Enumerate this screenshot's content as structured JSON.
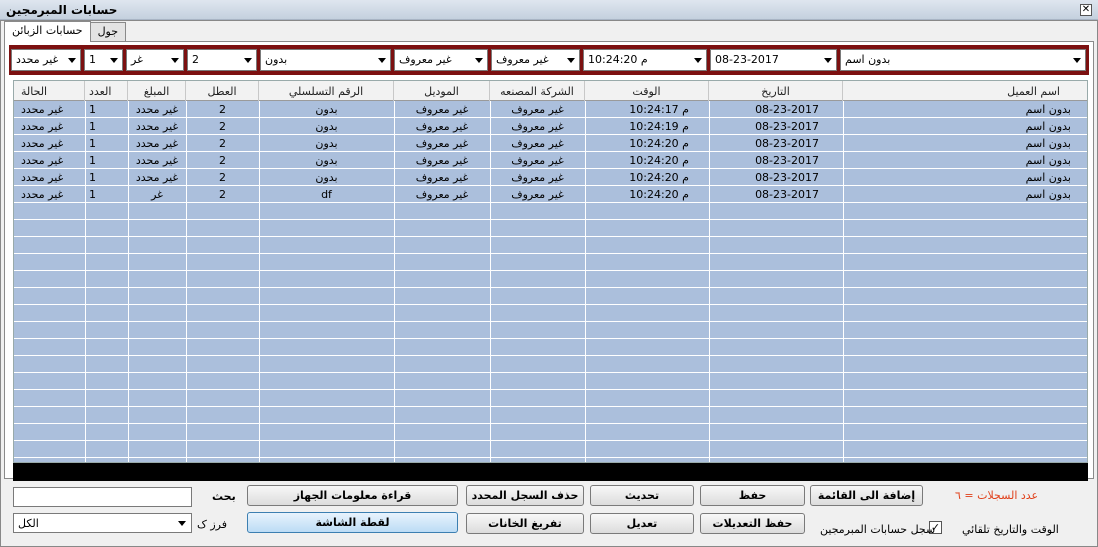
{
  "window": {
    "title": "حسابات المبرمجين",
    "close_glyph": "✕"
  },
  "tabs": [
    {
      "label": "حسابات الزبائن"
    },
    {
      "label": "جول"
    }
  ],
  "filters": {
    "customer_name": "بدون اسم",
    "date": "08-23-2017",
    "time": "م 10:24:20",
    "company": "غير معروف",
    "model": "غير معروف",
    "serial": "بدون",
    "fault": "2",
    "amount": "غر",
    "count": "1",
    "status": "غير محدد"
  },
  "table": {
    "headers": {
      "customer_name": "اسم العميل",
      "date": "التاريخ",
      "time": "الوقت",
      "company": "الشركة المصنعه",
      "model": "الموديل",
      "serial": "الرقم التسلسلي",
      "fault": "العطل",
      "amount": "المبلغ",
      "count": "العدد",
      "status": "الحالة"
    },
    "rows": [
      {
        "customer_name": "بدون اسم",
        "date": "08-23-2017",
        "time": "م 10:24:17",
        "company": "غير معروف",
        "model": "غير معروف",
        "serial": "بدون",
        "fault": "2",
        "amount": "غير محدد",
        "count": "1",
        "status": "غير محدد"
      },
      {
        "customer_name": "بدون اسم",
        "date": "08-23-2017",
        "time": "م 10:24:19",
        "company": "غير معروف",
        "model": "غير معروف",
        "serial": "بدون",
        "fault": "2",
        "amount": "غير محدد",
        "count": "1",
        "status": "غير محدد"
      },
      {
        "customer_name": "بدون اسم",
        "date": "08-23-2017",
        "time": "م 10:24:20",
        "company": "غير معروف",
        "model": "غير معروف",
        "serial": "بدون",
        "fault": "2",
        "amount": "غير محدد",
        "count": "1",
        "status": "غير محدد"
      },
      {
        "customer_name": "بدون اسم",
        "date": "08-23-2017",
        "time": "م 10:24:20",
        "company": "غير معروف",
        "model": "غير معروف",
        "serial": "بدون",
        "fault": "2",
        "amount": "غير محدد",
        "count": "1",
        "status": "غير محدد"
      },
      {
        "customer_name": "بدون اسم",
        "date": "08-23-2017",
        "time": "م 10:24:20",
        "company": "غير معروف",
        "model": "غير معروف",
        "serial": "بدون",
        "fault": "2",
        "amount": "غير محدد",
        "count": "1",
        "status": "غير محدد"
      },
      {
        "customer_name": "بدون اسم",
        "date": "08-23-2017",
        "time": "م 10:24:20",
        "company": "غير معروف",
        "model": "غير معروف",
        "serial": "df",
        "fault": "2",
        "amount": "غر",
        "count": "1",
        "status": "غير محدد"
      }
    ]
  },
  "footer": {
    "record_count": "عدد السجلات = ٦",
    "auto_datetime_label": "الوقت والتاريخ تلقائي",
    "auto_datetime_checked": true,
    "programmers_log_label": "سجل حسابات المبرمجين",
    "search_label": "بحث",
    "sort_label": "فرز ک",
    "sort_value": "الكل",
    "buttons": {
      "add_to_list": "إضافة الى القائمة",
      "save": "حفظ",
      "refresh": "تحديث",
      "delete_selected": "حذف السجل المحدد",
      "read_device_info": "قراءة معلومات الجهاز",
      "save_edits": "حفظ التعديلات",
      "edit": "تعديل",
      "clear_fields": "تفريغ الخانات",
      "screenshot": "لقطة الشاشة"
    }
  },
  "colors": {
    "filter_bar": "#7c1010",
    "grid_bg": "#abbfdc",
    "record_count": "#e0401a"
  }
}
